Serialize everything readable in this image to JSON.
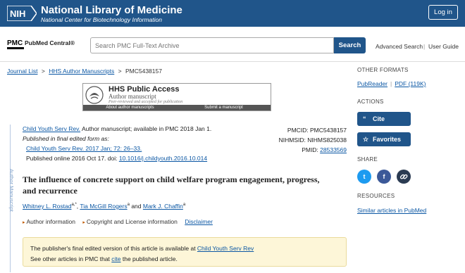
{
  "header": {
    "logo_text": "NIH",
    "title": "National Library of Medicine",
    "subtitle": "National Center for Biotechnology Information",
    "login_label": "Log in"
  },
  "search": {
    "logo_mark": "PMC",
    "logo_name": "PubMed Central®",
    "placeholder": "Search PMC Full-Text Archive",
    "button_label": "Search",
    "advanced_label": "Advanced Search",
    "separator": "|",
    "user_guide_label": "User Guide"
  },
  "breadcrumb": {
    "items": [
      "Journal List",
      "HHS Author Manuscripts"
    ],
    "current": "PMC5438157",
    "separator": ">"
  },
  "hhs_banner": {
    "title": "HHS Public Access",
    "subtitle": "Author manuscript",
    "note": "Peer-reviewed and accepted for publication",
    "link_about": "About author manuscripts",
    "link_submit": "Submit a manuscript"
  },
  "side_label": "Author Manuscript",
  "citation": {
    "journal_link": "Child Youth Serv Rev.",
    "line1_rest": " Author manuscript; available in PMC 2018 Jan 1.",
    "line2": "Published in final edited form as:",
    "line3_link": "Child Youth Serv Rev. 2017 Jan; 72: 26–33.",
    "line4_prefix": "Published online 2016 Oct 17. doi: ",
    "doi_link": "10.1016/j.childyouth.2016.10.014"
  },
  "ids": {
    "pmcid": "PMCID: PMC5438157",
    "nihmsid": "NIHMSID: NIHMS825038",
    "pmid_label": "PMID: ",
    "pmid_link": "28533569"
  },
  "article": {
    "title": "The influence of concrete support on child welfare program engagement, progress, and recurrence",
    "authors": [
      {
        "name": "Whitney L. Rostad",
        "sup": "a,*"
      },
      {
        "name": "Tia McGill Rogers",
        "sup": "a"
      },
      {
        "name": "Mark J. Chaffin",
        "sup": "a"
      }
    ],
    "author_sep1": ", ",
    "author_sep2": " and ",
    "author_info": "Author information",
    "copyright_info": "Copyright and License information",
    "disclaimer": "Disclaimer"
  },
  "notice": {
    "line1_prefix": "The publisher's final edited version of this article is available at ",
    "line1_link": "Child Youth Serv Rev",
    "line2_prefix": "See other articles in PMC that ",
    "line2_link": "cite",
    "line2_suffix": " the published article."
  },
  "sidebar": {
    "other_formats": "OTHER FORMATS",
    "pubreader": "PubReader",
    "pdf": "PDF (119K)",
    "actions": "ACTIONS",
    "cite_label": "Cite",
    "favorites_label": "Favorites",
    "share": "SHARE",
    "twitter": "t",
    "facebook": "f",
    "resources": "RESOURCES",
    "similar": "Similar articles in PubMed"
  },
  "colors": {
    "primary": "#20558a",
    "link": "#0b57a4",
    "notice_bg": "#fdf6d8",
    "twitter": "#1d9bf0",
    "facebook": "#3b5998",
    "link_share": "#2b3b52"
  }
}
